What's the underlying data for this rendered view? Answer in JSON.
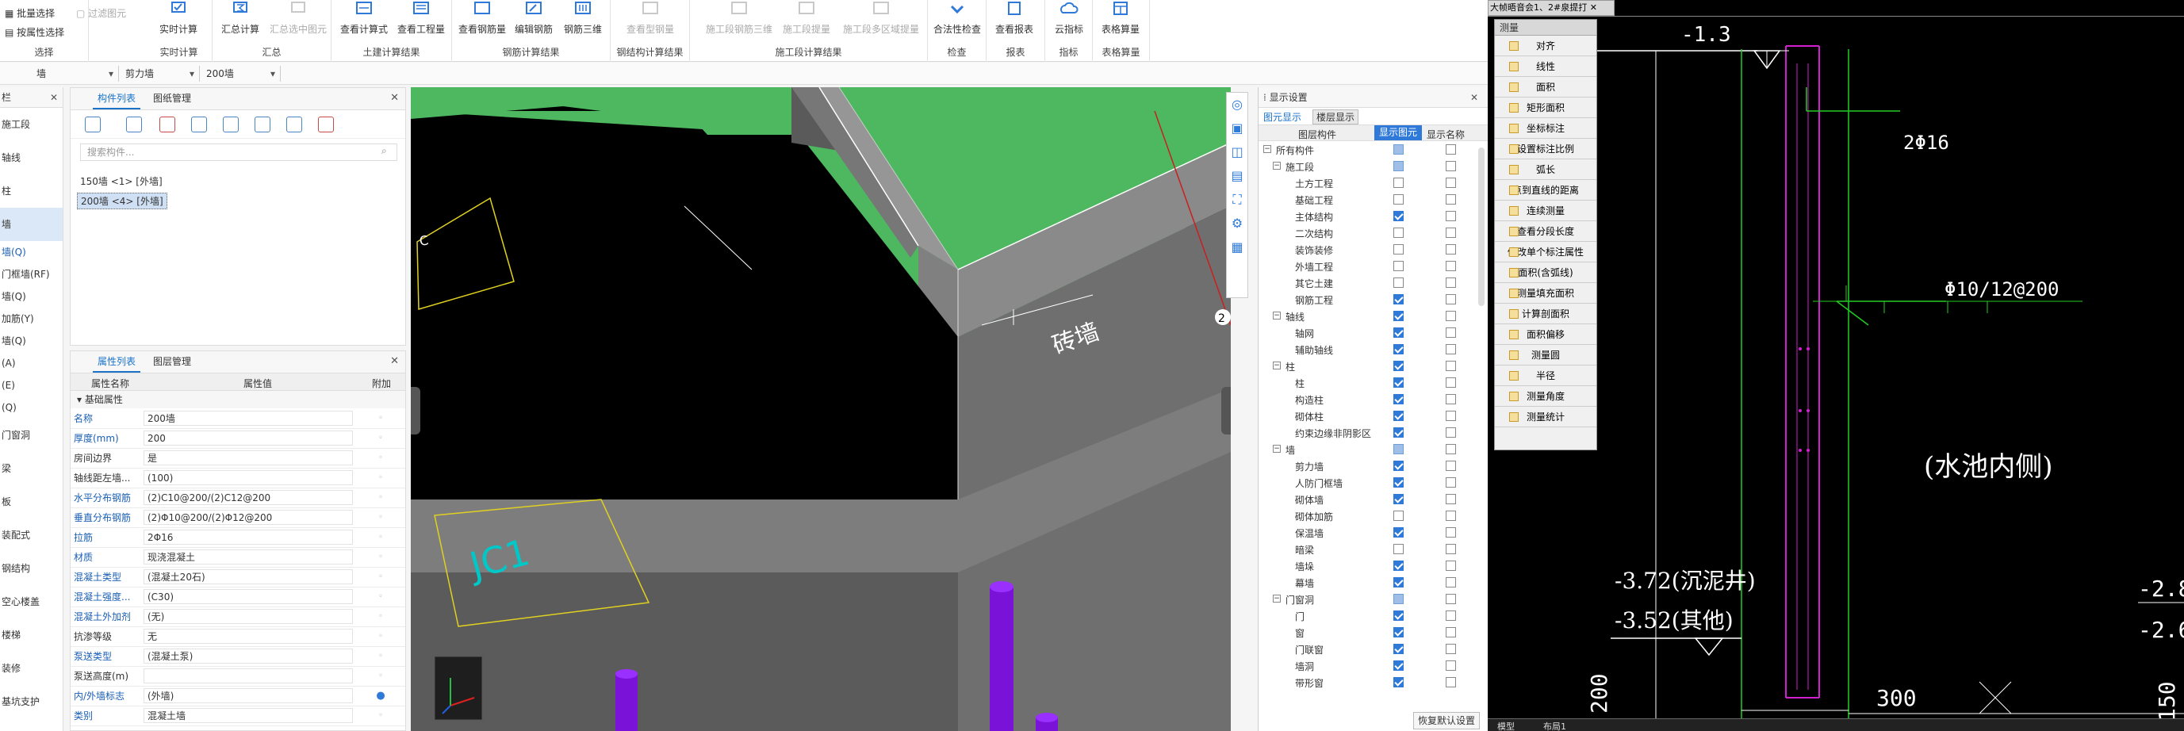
{
  "ribbon": {
    "small_buttons": [
      "批量选择",
      "按属性选择",
      "过滤图元"
    ],
    "groups": [
      {
        "label": "选择",
        "buttons": []
      },
      {
        "label": "实时计算",
        "buttons": [
          "实时计算"
        ]
      },
      {
        "label": "汇总",
        "buttons": [
          "汇总计算",
          "汇总选中图元"
        ]
      },
      {
        "label": "土建计算结果",
        "buttons": [
          "查看计算式",
          "查看工程量"
        ]
      },
      {
        "label": "钢筋计算结果",
        "buttons": [
          "查看钢筋量",
          "编辑钢筋",
          "钢筋三维"
        ]
      },
      {
        "label": "钢结构计算结果",
        "buttons": [
          "查看型钢量"
        ]
      },
      {
        "label": "施工段计算结果",
        "buttons": [
          "施工段钢筋三维",
          "施工段提量",
          "施工段多区域提量"
        ]
      },
      {
        "label": "检查",
        "buttons": [
          "合法性检查"
        ]
      },
      {
        "label": "报表",
        "buttons": [
          "查看报表"
        ]
      },
      {
        "label": "指标",
        "buttons": [
          "云指标"
        ]
      },
      {
        "label": "表格算量",
        "buttons": [
          "表格算量"
        ]
      }
    ]
  },
  "selectors": [
    "墙",
    "剪力墙",
    "200墙"
  ],
  "nav": {
    "title": "栏",
    "items": [
      "施工段",
      "轴线",
      "柱",
      "墙"
    ],
    "active": "墙",
    "sub_items": [
      "墙(Q)",
      "门框墙(RF)",
      "墙(Q)",
      "加筋(Y)",
      "墙(Q)",
      "(A)",
      "(E)",
      "(Q)"
    ],
    "more_items": [
      "门窗洞",
      "梁",
      "板",
      "装配式",
      "钢结构",
      "空心楼盖",
      "楼梯",
      "装修",
      "基坑支护"
    ]
  },
  "component_panel": {
    "tabs": [
      "构件列表",
      "图纸管理"
    ],
    "search_placeholder": "搜索构件...",
    "items": [
      "150墙 <1> [外墙]",
      "200墙 <4> [外墙]"
    ]
  },
  "property_panel": {
    "tabs": [
      "属性列表",
      "图层管理"
    ],
    "headers": [
      "属性名称",
      "属性值",
      "附加"
    ],
    "section": "基础属性",
    "rows": [
      {
        "name": "名称",
        "value": "200墙"
      },
      {
        "name": "厚度(mm)",
        "value": "200"
      },
      {
        "name": "房间边界",
        "value": "是"
      },
      {
        "name": "轴线距左墙...",
        "value": "(100)"
      },
      {
        "name": "水平分布钢筋",
        "value": "(2)C10@200/(2)C12@200"
      },
      {
        "name": "垂直分布钢筋",
        "value": "(2)Φ10@200/(2)Φ12@200"
      },
      {
        "name": "拉筋",
        "value": "2Φ16"
      },
      {
        "name": "材质",
        "value": "现浇混凝土"
      },
      {
        "name": "混凝土类型",
        "value": "(混凝土20石)"
      },
      {
        "name": "混凝土强度...",
        "value": "(C30)"
      },
      {
        "name": "混凝土外加剂",
        "value": "(无)"
      },
      {
        "name": "抗渗等级",
        "value": "无"
      },
      {
        "name": "泵送类型",
        "value": "(混凝土泵)"
      },
      {
        "name": "泵送高度(m)",
        "value": ""
      },
      {
        "name": "内/外墙标志",
        "value": "(外墙)"
      },
      {
        "name": "类别",
        "value": "混凝土墙"
      }
    ]
  },
  "viewport": {
    "labels": [
      "砖墙",
      "JC1"
    ],
    "edge_number": "2"
  },
  "display_settings": {
    "title": "显示设置",
    "tabs": [
      "图元显示",
      "楼层显示"
    ],
    "headers": [
      "图层构件",
      "显示图元",
      "显示名称"
    ],
    "rows": [
      {
        "label": "所有构件",
        "level": 0,
        "show": "part",
        "name": false
      },
      {
        "label": "施工段",
        "level": 1,
        "show": "part",
        "name": false
      },
      {
        "label": "土方工程",
        "level": 2,
        "show": "off",
        "name": false
      },
      {
        "label": "基础工程",
        "level": 2,
        "show": "off",
        "name": false
      },
      {
        "label": "主体结构",
        "level": 2,
        "show": "on",
        "name": false
      },
      {
        "label": "二次结构",
        "level": 2,
        "show": "off",
        "name": false
      },
      {
        "label": "装饰装修",
        "level": 2,
        "show": "off",
        "name": false
      },
      {
        "label": "外墙工程",
        "level": 2,
        "show": "off",
        "name": false
      },
      {
        "label": "其它土建",
        "level": 2,
        "show": "off",
        "name": false
      },
      {
        "label": "钢筋工程",
        "level": 2,
        "show": "on",
        "name": false
      },
      {
        "label": "轴线",
        "level": 1,
        "show": "on",
        "name": false
      },
      {
        "label": "轴网",
        "level": 2,
        "show": "on",
        "name": false
      },
      {
        "label": "辅助轴线",
        "level": 2,
        "show": "on",
        "name": false
      },
      {
        "label": "柱",
        "level": 1,
        "show": "on",
        "name": false
      },
      {
        "label": "柱",
        "level": 2,
        "show": "on",
        "name": false
      },
      {
        "label": "构造柱",
        "level": 2,
        "show": "on",
        "name": false
      },
      {
        "label": "砌体柱",
        "level": 2,
        "show": "on",
        "name": false
      },
      {
        "label": "约束边缘非阴影区",
        "level": 2,
        "show": "on",
        "name": false
      },
      {
        "label": "墙",
        "level": 1,
        "show": "part",
        "name": false
      },
      {
        "label": "剪力墙",
        "level": 2,
        "show": "on",
        "name": false
      },
      {
        "label": "人防门框墙",
        "level": 2,
        "show": "on",
        "name": false
      },
      {
        "label": "砌体墙",
        "level": 2,
        "show": "on",
        "name": false
      },
      {
        "label": "砌体加筋",
        "level": 2,
        "show": "off",
        "name": false
      },
      {
        "label": "保温墙",
        "level": 2,
        "show": "on",
        "name": false
      },
      {
        "label": "暗梁",
        "level": 2,
        "show": "off",
        "name": false
      },
      {
        "label": "墙垛",
        "level": 2,
        "show": "on",
        "name": false
      },
      {
        "label": "幕墙",
        "level": 2,
        "show": "on",
        "name": false
      },
      {
        "label": "门窗洞",
        "level": 1,
        "show": "part",
        "name": false
      },
      {
        "label": "门",
        "level": 2,
        "show": "on",
        "name": false
      },
      {
        "label": "窗",
        "level": 2,
        "show": "on",
        "name": false
      },
      {
        "label": "门联窗",
        "level": 2,
        "show": "on",
        "name": false
      },
      {
        "label": "墙洞",
        "level": 2,
        "show": "on",
        "name": false
      },
      {
        "label": "带形窗",
        "level": 2,
        "show": "on",
        "name": false
      }
    ],
    "restore_button": "恢复默认设置"
  },
  "cad": {
    "tab_title": "大帧晤音会1、2#泉提打",
    "measure_title": "测量",
    "measure_items": [
      "对齐",
      "线性",
      "面积",
      "矩形面积",
      "坐标标注",
      "设置标注比例",
      "弧长",
      "点到直线的距离",
      "连续测量",
      "查看分段长度",
      "修改单个标注属性",
      "面积(含弧线)",
      "测量填充面积",
      "计算剖面积",
      "面积偏移",
      "测量圆",
      "半径",
      "测量角度",
      "测量统计"
    ],
    "annotations": [
      "-1.3",
      "2Φ16",
      "Φ10/12@200",
      "(水池内侧)",
      "-3.72(沉泥井)",
      "-3.52(其他)",
      "-2.8",
      "-2.6",
      "200",
      "300",
      "150"
    ],
    "bottom_tabs": [
      "模型",
      "布局1"
    ]
  },
  "colors": {
    "accent": "#1a73c8",
    "green_plane": "#4db85f",
    "wall_gray": "#7d7d7d",
    "column_purple": "#7a12d8",
    "cad_magenta": "#d020d0",
    "cad_green": "#22cc22"
  }
}
